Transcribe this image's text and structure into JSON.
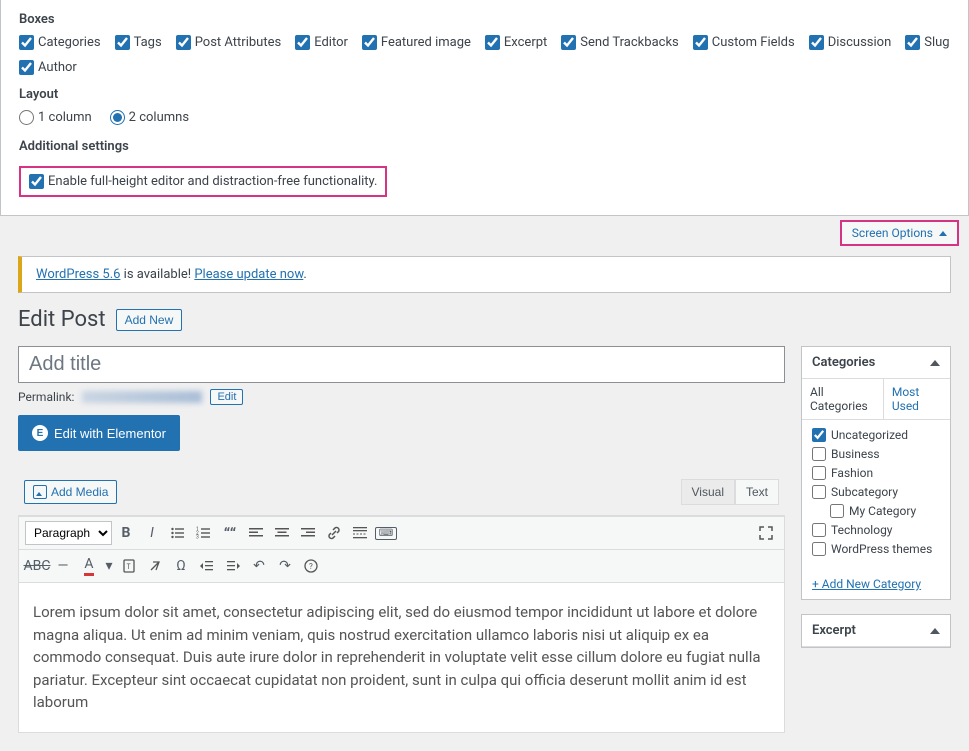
{
  "screen_options": {
    "boxes_heading": "Boxes",
    "boxes": [
      {
        "label": "Categories",
        "checked": true
      },
      {
        "label": "Tags",
        "checked": true
      },
      {
        "label": "Post Attributes",
        "checked": true
      },
      {
        "label": "Editor",
        "checked": true
      },
      {
        "label": "Featured image",
        "checked": true
      },
      {
        "label": "Excerpt",
        "checked": true
      },
      {
        "label": "Send Trackbacks",
        "checked": true
      },
      {
        "label": "Custom Fields",
        "checked": true
      },
      {
        "label": "Discussion",
        "checked": true
      },
      {
        "label": "Slug",
        "checked": true
      },
      {
        "label": "Author",
        "checked": true
      }
    ],
    "layout_heading": "Layout",
    "layout_options": [
      {
        "label": "1 column",
        "checked": false
      },
      {
        "label": "2 columns",
        "checked": true
      }
    ],
    "additional_heading": "Additional settings",
    "additional_label": "Enable full-height editor and distraction-free functionality.",
    "additional_checked": true,
    "tab_label": "Screen Options"
  },
  "update_nag": {
    "link1": "WordPress 5.6",
    "text": " is available! ",
    "link2": "Please update now"
  },
  "header": {
    "title": "Edit Post",
    "add_new": "Add New"
  },
  "post": {
    "title_placeholder": "Add title",
    "permalink_label": "Permalink:",
    "edit_label": "Edit",
    "elementor_btn": "Edit with Elementor",
    "add_media": "Add Media",
    "tabs": {
      "visual": "Visual",
      "text": "Text"
    },
    "format_select": "Paragraph",
    "content": "Lorem ipsum dolor sit amet, consectetur adipiscing elit, sed do eiusmod tempor incididunt ut labore et dolore magna aliqua. Ut enim ad minim veniam, quis nostrud exercitation ullamco laboris nisi ut aliquip ex ea commodo consequat. Duis aute irure dolor in reprehenderit in voluptate velit esse cillum dolore eu fugiat nulla pariatur. Excepteur sint occaecat cupidatat non proident, sunt in culpa qui officia deserunt mollit anim id est laborum"
  },
  "categories": {
    "title": "Categories",
    "tab_all": "All Categories",
    "tab_most": "Most Used",
    "items": [
      {
        "label": "Uncategorized",
        "checked": true,
        "indent": false
      },
      {
        "label": "Business",
        "checked": false,
        "indent": false
      },
      {
        "label": "Fashion",
        "checked": false,
        "indent": false
      },
      {
        "label": "Subcategory",
        "checked": false,
        "indent": false
      },
      {
        "label": "My Category",
        "checked": false,
        "indent": true
      },
      {
        "label": "Technology",
        "checked": false,
        "indent": false
      },
      {
        "label": "WordPress themes",
        "checked": false,
        "indent": false
      }
    ],
    "add_new": "+ Add New Category"
  },
  "excerpt": {
    "title": "Excerpt"
  }
}
